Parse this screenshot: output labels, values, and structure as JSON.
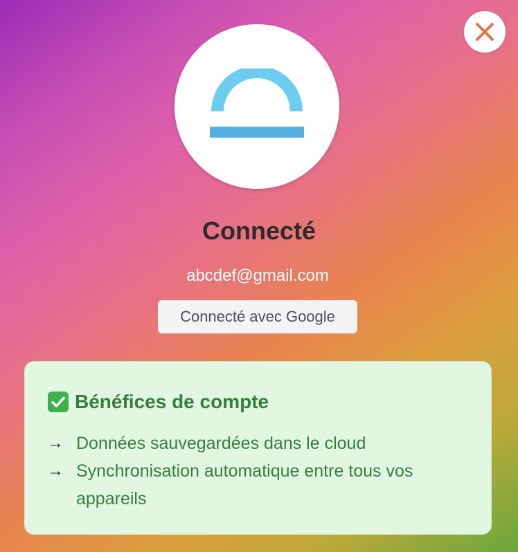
{
  "header": {
    "close_icon": "close-icon",
    "logo_icon": "sunrise-logo-icon",
    "colors": {
      "logo_arc": "#6dcdf0",
      "logo_bar": "#56b1e0",
      "close_x": "#e07447"
    }
  },
  "account": {
    "title": "Connecté",
    "email": "abcdef@gmail.com",
    "provider_label": "Connecté avec Google"
  },
  "benefits": {
    "title_icon": "check-box-icon",
    "title": "Bénéfices de compte",
    "items": [
      {
        "arrow": "→",
        "text": "Données sauvegardées dans le cloud"
      },
      {
        "arrow": "→",
        "text": "Synchronisation automatique entre tous vos appareils"
      }
    ],
    "colors": {
      "card_bg": "#e1f7e2",
      "text": "#357f3c",
      "check": "#3fb04c"
    }
  }
}
